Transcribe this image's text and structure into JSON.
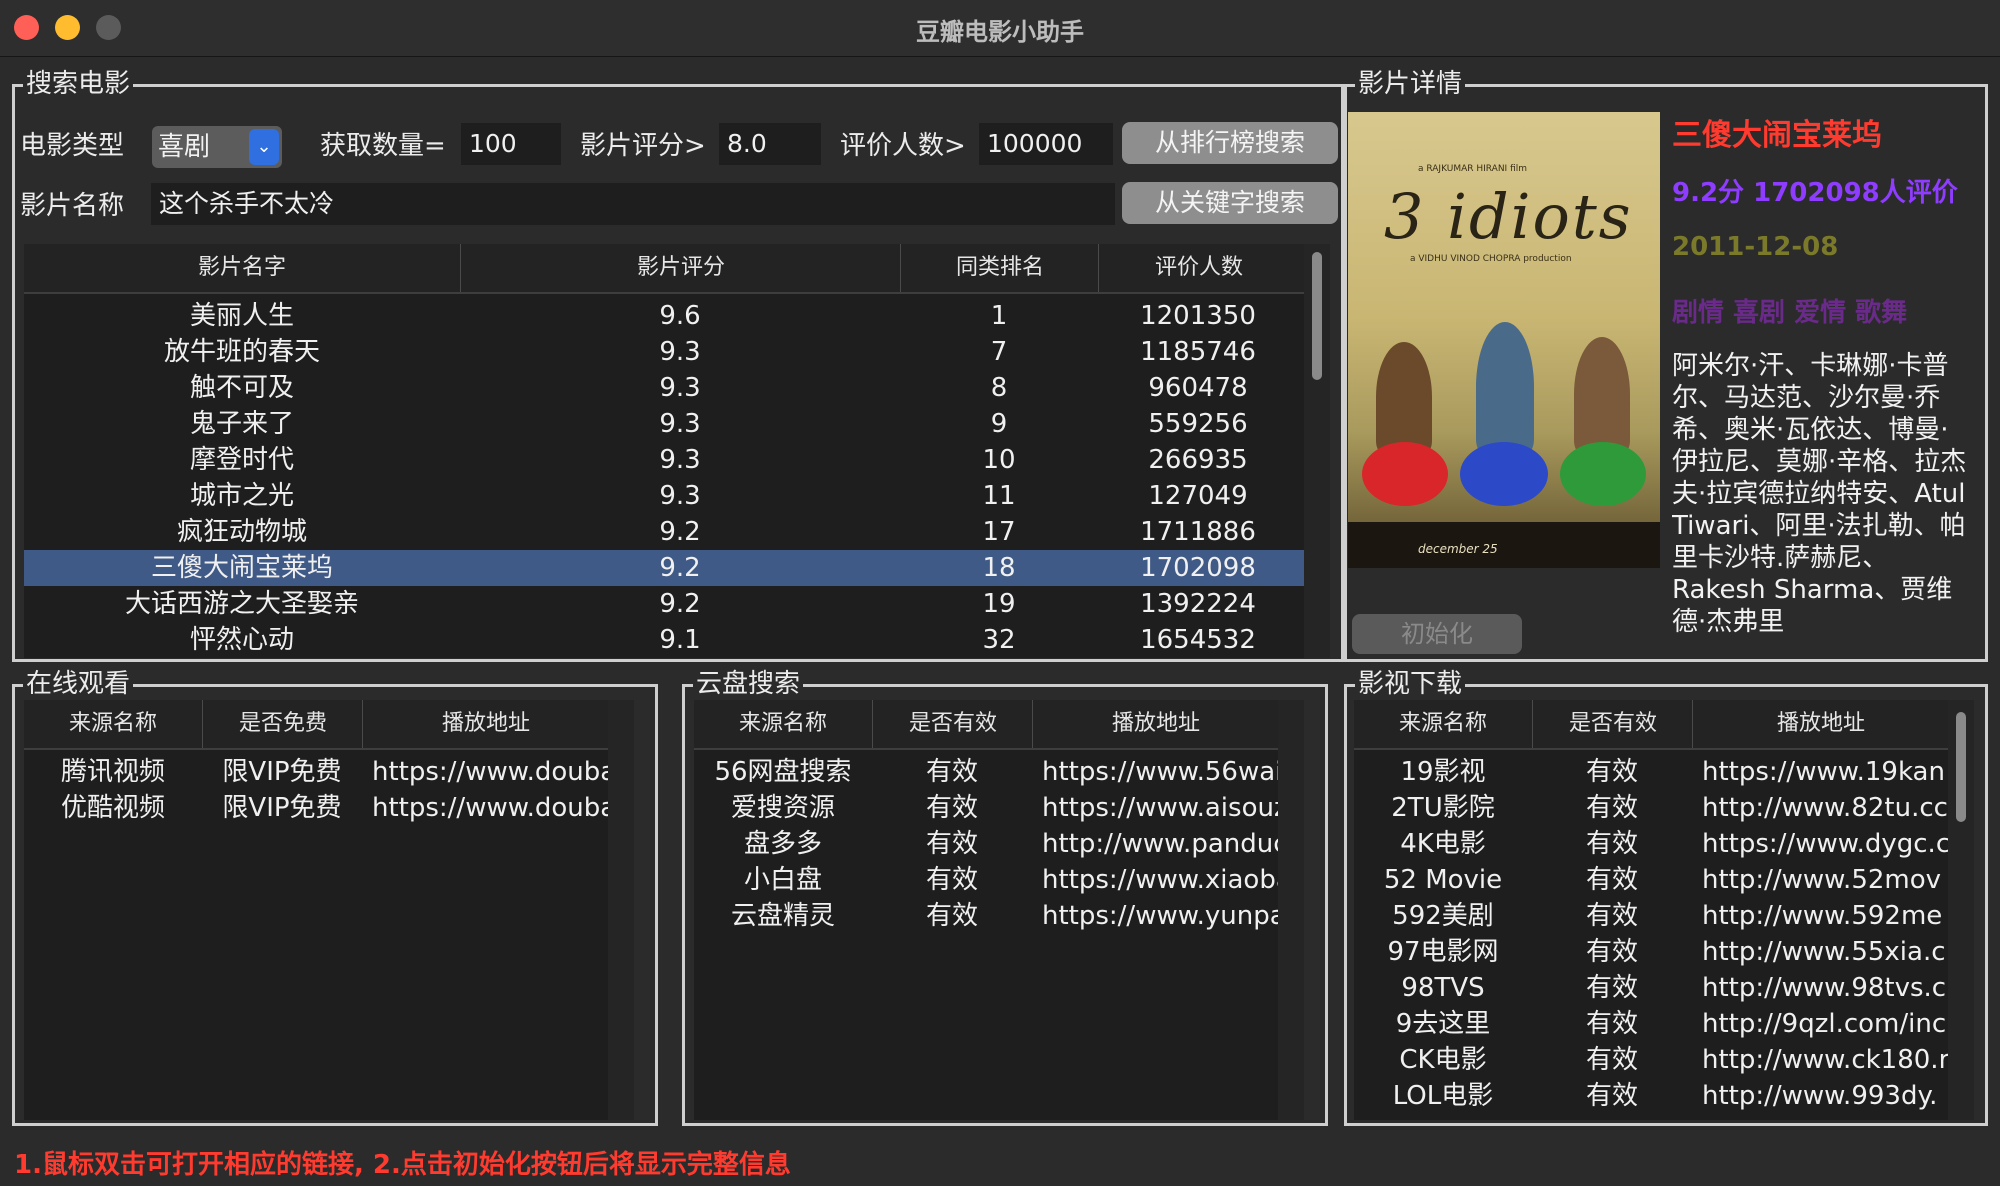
{
  "window": {
    "title": "豆瓣电影小助手"
  },
  "search": {
    "group_title": "搜索电影",
    "type_label": "电影类型",
    "type_value": "喜剧",
    "count_label": "获取数量=",
    "count_value": "100",
    "score_label": "影片评分>",
    "score_value": "8.0",
    "votes_label": "评价人数>",
    "votes_value": "100000",
    "rank_search_button": "从排行榜搜索",
    "name_label": "影片名称",
    "name_value": "这个杀手不太冷",
    "keyword_search_button": "从关键字搜索"
  },
  "results": {
    "columns": [
      "影片名字",
      "影片评分",
      "同类排名",
      "评价人数"
    ],
    "rows": [
      [
        "美丽人生",
        "9.6",
        "1",
        "1201350"
      ],
      [
        "放牛班的春天",
        "9.3",
        "7",
        "1185746"
      ],
      [
        "触不可及",
        "9.3",
        "8",
        "960478"
      ],
      [
        "鬼子来了",
        "9.3",
        "9",
        "559256"
      ],
      [
        "摩登时代",
        "9.3",
        "10",
        "266935"
      ],
      [
        "城市之光",
        "9.3",
        "11",
        "127049"
      ],
      [
        "疯狂动物城",
        "9.2",
        "17",
        "1711886"
      ],
      [
        "三傻大闹宝莱坞",
        "9.2",
        "18",
        "1702098"
      ],
      [
        "大话西游之大圣娶亲",
        "9.2",
        "19",
        "1392224"
      ],
      [
        "怦然心动",
        "9.1",
        "32",
        "1654532"
      ]
    ],
    "selected_index": 7
  },
  "detail": {
    "group_title": "影片详情",
    "poster_title": "3 idiots",
    "poster_credit_top": "a RAJKUMAR HIRANI film",
    "poster_credit_sub": "a VIDHU VINOD CHOPRA production",
    "poster_release": "december 25",
    "title": "三傻大闹宝莱坞",
    "score_line": "9.2分 1702098人评价",
    "date": "2011-12-08",
    "genres": "剧情 喜剧 爱情 歌舞",
    "cast": "阿米尔·汗、卡琳娜·卡普尔、马达范、沙尔曼·乔希、奥米·瓦依达、博曼·伊拉尼、莫娜·辛格、拉杰夫·拉宾德拉纳特安、Atul Tiwari、阿里·法扎勒、帕里卡沙特.萨赫尼、Rakesh Sharma、贾维德·杰弗里",
    "init_button": "初始化"
  },
  "online": {
    "group_title": "在线观看",
    "columns": [
      "来源名称",
      "是否免费",
      "播放地址"
    ],
    "rows": [
      [
        "腾讯视频",
        "限VIP免费",
        "https://www.douba"
      ],
      [
        "优酷视频",
        "限VIP免费",
        "https://www.douba"
      ]
    ]
  },
  "cloud": {
    "group_title": "云盘搜索",
    "columns": [
      "来源名称",
      "是否有效",
      "播放地址"
    ],
    "rows": [
      [
        "56网盘搜索",
        "有效",
        "https://www.56wai"
      ],
      [
        "爱搜资源",
        "有效",
        "https://www.aisouz"
      ],
      [
        "盘多多",
        "有效",
        "http://www.panduc"
      ],
      [
        "小白盘",
        "有效",
        "https://www.xiaoba"
      ],
      [
        "云盘精灵",
        "有效",
        "https://www.yunpa"
      ]
    ]
  },
  "download": {
    "group_title": "影视下载",
    "columns": [
      "来源名称",
      "是否有效",
      "播放地址"
    ],
    "rows": [
      [
        "19影视",
        "有效",
        "https://www.19kan"
      ],
      [
        "2TU影院",
        "有效",
        "http://www.82tu.cc"
      ],
      [
        "4K电影",
        "有效",
        "https://www.dygc.c"
      ],
      [
        "52 Movie",
        "有效",
        "http://www.52mov"
      ],
      [
        "592美剧",
        "有效",
        "http://www.592me"
      ],
      [
        "97电影网",
        "有效",
        "http://www.55xia.c"
      ],
      [
        "98TVS",
        "有效",
        "http://www.98tvs.c"
      ],
      [
        "9去这里",
        "有效",
        "http://9qzl.com/inc"
      ],
      [
        "CK电影",
        "有效",
        "http://www.ck180.r"
      ],
      [
        "LOL电影",
        "有效",
        "http://www.993dy."
      ]
    ]
  },
  "footer_note": "1.鼠标双击可打开相应的链接, 2.点击初始化按钮后将显示完整信息"
}
